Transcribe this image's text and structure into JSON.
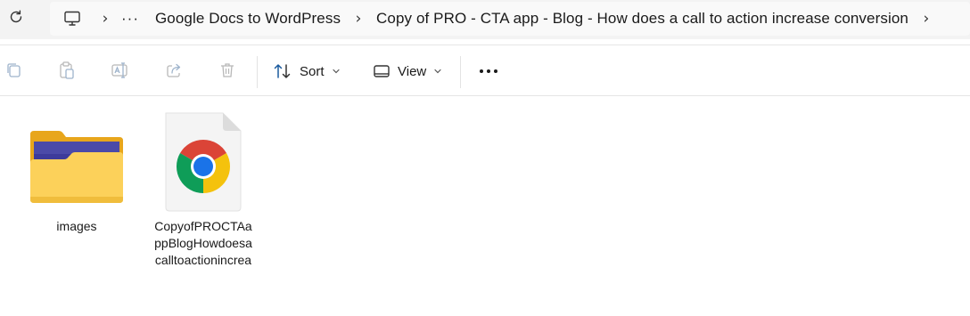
{
  "address_bar": {
    "crumbs": [
      "Google Docs to WordPress",
      "Copy of PRO - CTA app - Blog - How does a call to action increase conversion"
    ],
    "overflow_label": "···"
  },
  "toolbar": {
    "sort_label": "Sort",
    "view_label": "View",
    "more_label": "•••"
  },
  "files": [
    {
      "name": "images",
      "type": "folder",
      "icon": "folder-icon"
    },
    {
      "name": "CopyofPROCTAappBlogHowdoesacalltoactionincrea",
      "type": "html-file",
      "icon": "chrome-icon"
    }
  ],
  "colors": {
    "folder_back": "#e8a61c",
    "folder_front": "#fcd15a",
    "folder_paper": "#3d3b9b",
    "chrome_red": "#db4437",
    "chrome_yellow": "#f4c20d",
    "chrome_green": "#0f9d58",
    "chrome_blue": "#1a73e8"
  }
}
